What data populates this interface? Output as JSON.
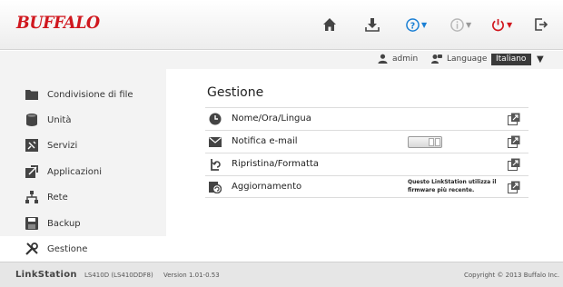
{
  "brand": {
    "logo": "BUFFALO",
    "accent": "#d0171e"
  },
  "header": {
    "icons": [
      "home-icon",
      "download-icon",
      "help-icon",
      "info-icon",
      "power-icon",
      "logout-icon"
    ]
  },
  "userbar": {
    "user": "admin",
    "language_label": "Language",
    "language_value": "Italiano"
  },
  "sidebar": {
    "items": [
      {
        "label": "Condivisione di file",
        "icon": "folder-icon"
      },
      {
        "label": "Unità",
        "icon": "drive-icon"
      },
      {
        "label": "Servizi",
        "icon": "services-icon"
      },
      {
        "label": "Applicazioni",
        "icon": "applications-icon"
      },
      {
        "label": "Rete",
        "icon": "network-icon"
      },
      {
        "label": "Backup",
        "icon": "backup-icon"
      },
      {
        "label": "Gestione",
        "icon": "management-icon",
        "active": true
      }
    ]
  },
  "main": {
    "title": "Gestione",
    "rows": [
      {
        "label": "Nome/Ora/Lingua",
        "icon": "clock-icon"
      },
      {
        "label": "Notifica e-mail",
        "icon": "mail-icon",
        "toggle": "off"
      },
      {
        "label": "Ripristina/Formatta",
        "icon": "restore-icon"
      },
      {
        "label": "Aggiornamento",
        "icon": "update-icon",
        "note": "Questo LinkStation utilizza il firmware più recente."
      }
    ]
  },
  "footer": {
    "brand": "LinkStation",
    "model": "LS410D (LS410DDF8)",
    "version": "Version 1.01-0.53",
    "copyright": "Copyright © 2013 Buffalo Inc."
  }
}
